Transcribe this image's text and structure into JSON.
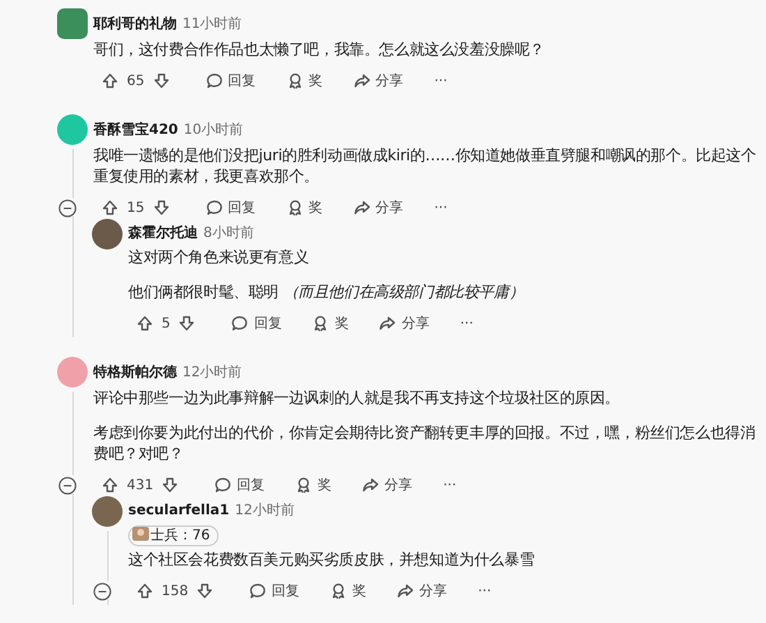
{
  "comments": [
    {
      "author": "耶利哥的礼物",
      "time": "11小时前",
      "color": "#3a8f5a",
      "kind": "square",
      "paragraphs": [
        "哥们，这付费合作作品也太懒了吧，我靠。怎么就这么没羞没臊呢？"
      ],
      "votes": "65",
      "actions": [
        "回复",
        "奖",
        "分享",
        "···"
      ]
    },
    {
      "author": "香酥雪宝420",
      "time": "10小时前",
      "color": "#1fc7a0",
      "kind": "circle",
      "collapsed": false,
      "paragraphs": [
        "我唯一遗憾的是他们没把juri的胜利动画做成kiri的……你知道她做垂直劈腿和嘲讽的那个。比起这个重复使用的素材，我更喜欢那个。"
      ],
      "votes": "15",
      "actions": [
        "回复",
        "奖",
        "分享",
        "···"
      ],
      "children": [
        {
          "author": "森霍尔托迪",
          "time": "8小时前",
          "color": "#6b5a4a",
          "kind": "circle",
          "paragraphs": [
            "这对两个角色来说更有意义",
            "他们俩都很时髦、聪明 *（而且他们在高级部门都比较平庸）*"
          ],
          "votes": "5",
          "actions": [
            "回复",
            "奖",
            "分享",
            "···"
          ]
        }
      ]
    },
    {
      "author": "特格斯帕尔德",
      "time": "12小时前",
      "color": "#f0a0a8",
      "kind": "circle",
      "collapsed": false,
      "paragraphs": [
        "评论中那些一边为此事辩解一边讽刺的人就是我不再支持这个垃圾社区的原因。",
        "考虑到你要为此付出的代价，你肯定会期待比资产翻转更丰厚的回报。不过，嘿，粉丝们怎么也得消费吧？对吧？"
      ],
      "votes": "431",
      "actions": [
        "回复",
        "奖",
        "分享",
        "···"
      ],
      "children": [
        {
          "author": "secularfella1",
          "time": "12小时前",
          "color": "#7a6650",
          "kind": "circle",
          "flair": "士兵：76",
          "collapsed": false,
          "paragraphs": [
            "这个社区会花费数百美元购买劣质皮肤，并想知道为什么暴雪"
          ],
          "votes": "158",
          "actions": [
            "回复",
            "奖",
            "分享",
            "···"
          ]
        }
      ]
    }
  ]
}
